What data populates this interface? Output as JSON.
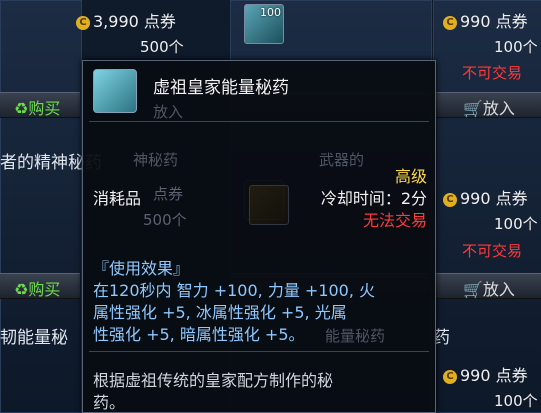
{
  "left_col": {
    "price": "3,990 点券",
    "qty": "500个",
    "buy_label": "购买",
    "section_title_1": "者的精神秘药",
    "price2_partial": "点券",
    "qty2_partial": "500个",
    "buy_label_2": "购买",
    "section_title_2": "韧能量秘",
    "qty3_partial": "500个"
  },
  "middle_col": {
    "slot_count": "100",
    "putin_partial": "放入",
    "section_title": "武器的"
  },
  "right_col": {
    "price_1": "990 点券",
    "qty_1": "100个",
    "status_1": "不可交易",
    "putin_1": "放入",
    "price_2": "990 点券",
    "qty_2": "100个",
    "status_2": "不可交易",
    "putin_2": "放入",
    "price_3": "990 点券",
    "qty_3": "100个",
    "section_title_partial": "药"
  },
  "tooltip": {
    "item_name": "虚祖皇家能量秘药",
    "grade": "高级",
    "type": "消耗品",
    "cooldown": "冷却时间：2分",
    "trade": "无法交易",
    "effect_header": "『使用效果』",
    "effect_line_1": "在120秒内 智力 +100, 力量 +100, 火",
    "effect_line_2": "属性强化 +5, 冰属性强化 +5, 光属",
    "effect_line_3": "性强化 +5, 暗属性强化 +5。",
    "desc_line_1": "根据虚祖传统的皇家配方制作的秘",
    "desc_line_2": "药。",
    "bg_partial_1": "点券",
    "bg_partial_2": "500个",
    "bg_partial_3": "放入",
    "bg_partial_4": "武器的",
    "bg_partial_5": "能量秘药",
    "bg_partial_6": "神秘药"
  },
  "colors": {
    "grade": "#ffd84a",
    "trade_red": "#ff3a3a",
    "effect_blue": "#8ec8ff",
    "coin": "#e0b020"
  }
}
